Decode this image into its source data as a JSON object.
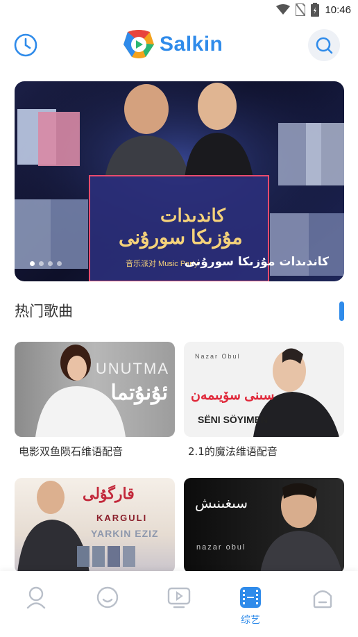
{
  "status": {
    "time": "10:46"
  },
  "header": {
    "logo_text": "Salkin"
  },
  "banner": {
    "caption": "كاندىدات مۇزىكا سورۇنى",
    "logo_line1": "كاندىدات",
    "logo_line2": "مۇزىكا سورۇنى",
    "logo_sub": "音乐派对 Music Party",
    "slide_count": 4,
    "active_slide": 1
  },
  "section": {
    "title": "热门歌曲"
  },
  "cards": [
    {
      "title": "电影双鱼陨石维语配音",
      "thumb_text1": "UNUTMA",
      "thumb_text2": "ئۇنۇتما"
    },
    {
      "title": "2.1的魔法维语配音",
      "thumb_text1": "Nazar Obul",
      "thumb_text2": "سىنى سۆيىمەن",
      "thumb_text3": "SËNI SÖYIMEN"
    },
    {
      "title": "",
      "thumb_text1": "قارگۇلى",
      "thumb_text2": "KARGULI",
      "thumb_text3": "YARKIN EZIZ"
    },
    {
      "title": "",
      "thumb_text1": "سىغىنىش",
      "thumb_text2": "nazar obul"
    }
  ],
  "nav": {
    "items": [
      {
        "icon": "user-icon"
      },
      {
        "icon": "smile-icon"
      },
      {
        "icon": "tv-play-icon"
      },
      {
        "icon": "film-icon",
        "label": "综艺",
        "active": true
      },
      {
        "icon": "home-icon"
      }
    ]
  },
  "colors": {
    "accent": "#2f8bea"
  }
}
